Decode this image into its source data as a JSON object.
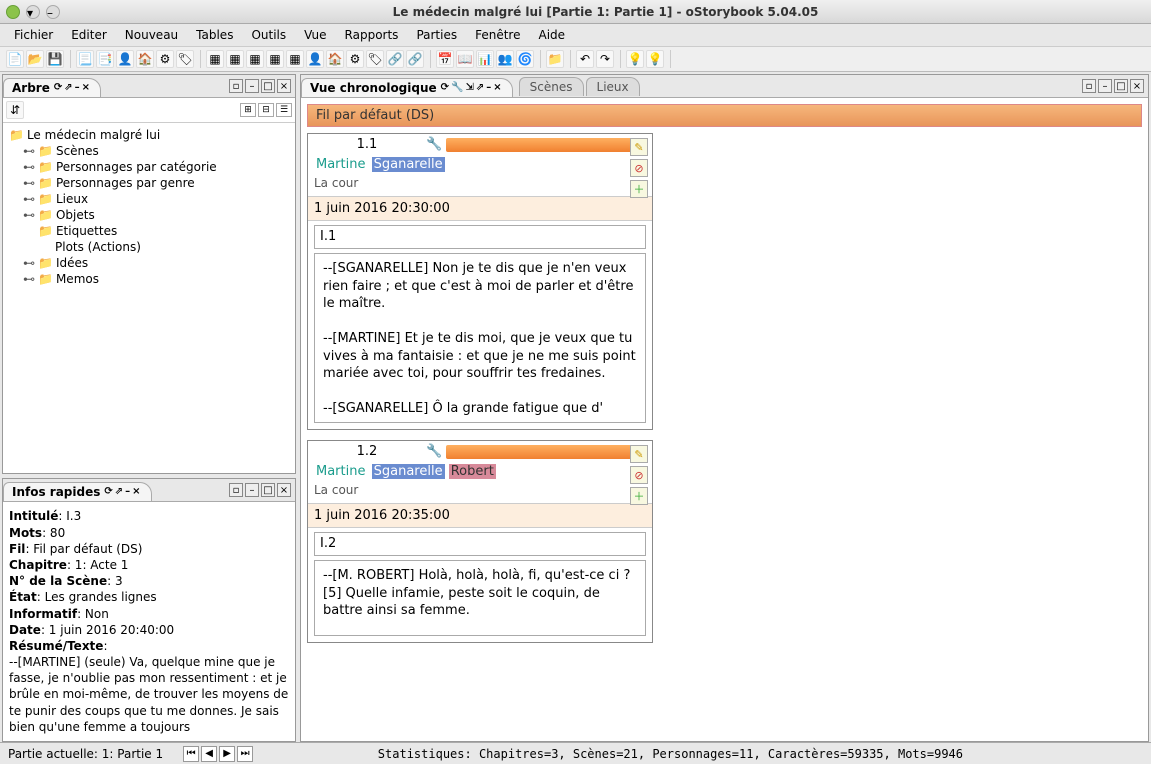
{
  "window": {
    "title": "Le médecin malgré lui [Partie 1: Partie 1] - oStorybook 5.04.05"
  },
  "menu": {
    "fichier": "Fichier",
    "editer": "Editer",
    "nouveau": "Nouveau",
    "tables": "Tables",
    "outils": "Outils",
    "vue": "Vue",
    "rapports": "Rapports",
    "parties": "Parties",
    "fenetre": "Fenêtre",
    "aide": "Aide"
  },
  "arbre": {
    "title": "Arbre",
    "root": "Le médecin malgré lui",
    "nodes": {
      "scenes": "Scènes",
      "pers_cat": "Personnages par catégorie",
      "pers_genre": "Personnages par genre",
      "lieux": "Lieux",
      "objets": "Objets",
      "etiquettes": "Etiquettes",
      "plots": "Plots (Actions)",
      "idees": "Idées",
      "memos": "Memos"
    }
  },
  "infos": {
    "title": "Infos rapides",
    "intitule_lbl": "Intitulé",
    "intitule_val": ": I.3",
    "mots_lbl": "Mots",
    "mots_val": ": 80",
    "fil_lbl": "Fil",
    "fil_val": ": Fil par défaut (DS)",
    "chap_lbl": "Chapitre",
    "chap_val": ": 1: Acte 1",
    "num_lbl": "N° de la Scène",
    "num_val": ": 3",
    "etat_lbl": "État",
    "etat_val": ": Les grandes lignes",
    "inf_lbl": "Informatif",
    "inf_val": ": Non",
    "date_lbl": "Date",
    "date_val": ": 1 juin 2016 20:40:00",
    "res_lbl": "Résumé/Texte",
    "res_val": ":",
    "text": "--[MARTINE] (seule) Va, quelque mine que je fasse, je n'oublie pas mon ressentiment : et je brûle en moi-même, de trouver les moyens de te punir des coups que tu me donnes. Je sais bien qu'une femme a toujours"
  },
  "chrono": {
    "title": "Vue chronologique",
    "tab_scenes": "Scènes",
    "tab_lieux": "Lieux",
    "strand": "Fil par défaut (DS)"
  },
  "scene1": {
    "num": "1.1",
    "martine": "Martine",
    "sganarelle": "Sganarelle",
    "loc": "La cour",
    "date": "1 juin 2016 20:30:00",
    "titre": "I.1",
    "p1": "--[SGANARELLE] Non je te dis que je n'en veux rien faire ; et que c'est à moi de parler et d'être le maître.",
    "p2": "--[MARTINE] Et je te dis moi, que je veux que tu vives à ma fantaisie : et que je ne me suis point mariée avec toi, pour souffrir tes fredaines.",
    "p3": "--[SGANARELLE] Ô la grande fatigue que d'"
  },
  "scene2": {
    "num": "1.2",
    "martine": "Martine",
    "sganarelle": "Sganarelle",
    "robert": "Robert",
    "loc": "La cour",
    "date": "1 juin 2016 20:35:00",
    "titre": "I.2",
    "p1": "--[M. ROBERT] Holà, holà, holà, fi, qu'est-ce ci ? [5] Quelle infamie, peste soit le coquin, de battre ainsi sa femme."
  },
  "status": {
    "partie": "Partie actuelle: 1: Partie 1",
    "stats": "Statistiques: Chapitres=3, Scènes=21, Personnages=11, Caractères=59335, Mots=9946"
  }
}
